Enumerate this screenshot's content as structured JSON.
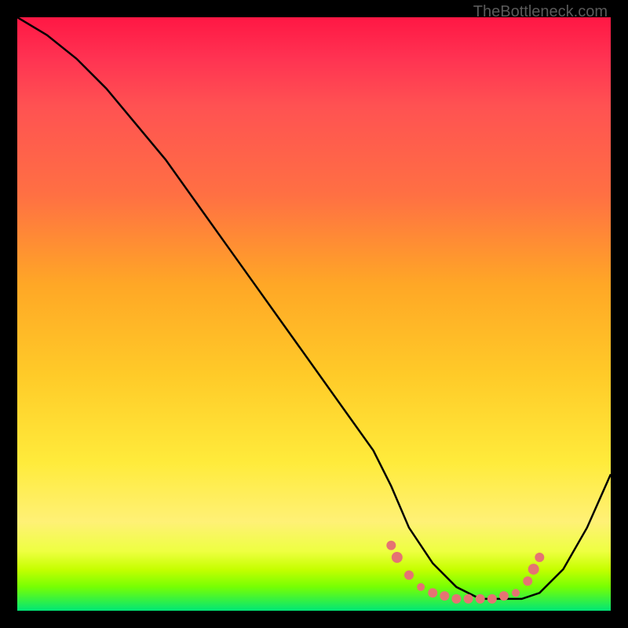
{
  "watermark": "TheBottleneck.com",
  "chart_data": {
    "type": "line",
    "title": "",
    "xlabel": "",
    "ylabel": "",
    "xlim": [
      0,
      100
    ],
    "ylim": [
      0,
      100
    ],
    "series": [
      {
        "name": "bottleneck-curve",
        "x": [
          0,
          5,
          10,
          15,
          20,
          25,
          30,
          35,
          40,
          45,
          50,
          55,
          60,
          63,
          66,
          70,
          74,
          78,
          82,
          85,
          88,
          92,
          96,
          100
        ],
        "y": [
          100,
          97,
          93,
          88,
          82,
          76,
          69,
          62,
          55,
          48,
          41,
          34,
          27,
          21,
          14,
          8,
          4,
          2,
          2,
          2,
          3,
          7,
          14,
          23
        ]
      }
    ],
    "markers": {
      "name": "highlight-dots",
      "points": [
        {
          "x": 63,
          "y": 11,
          "r": 6
        },
        {
          "x": 64,
          "y": 9,
          "r": 7
        },
        {
          "x": 66,
          "y": 6,
          "r": 6
        },
        {
          "x": 68,
          "y": 4,
          "r": 5
        },
        {
          "x": 70,
          "y": 3,
          "r": 6
        },
        {
          "x": 72,
          "y": 2.5,
          "r": 6
        },
        {
          "x": 74,
          "y": 2,
          "r": 6
        },
        {
          "x": 76,
          "y": 2,
          "r": 6
        },
        {
          "x": 78,
          "y": 2,
          "r": 6
        },
        {
          "x": 80,
          "y": 2,
          "r": 6
        },
        {
          "x": 82,
          "y": 2.5,
          "r": 6
        },
        {
          "x": 84,
          "y": 3,
          "r": 5
        },
        {
          "x": 86,
          "y": 5,
          "r": 6
        },
        {
          "x": 87,
          "y": 7,
          "r": 7
        },
        {
          "x": 88,
          "y": 9,
          "r": 6
        }
      ]
    }
  }
}
